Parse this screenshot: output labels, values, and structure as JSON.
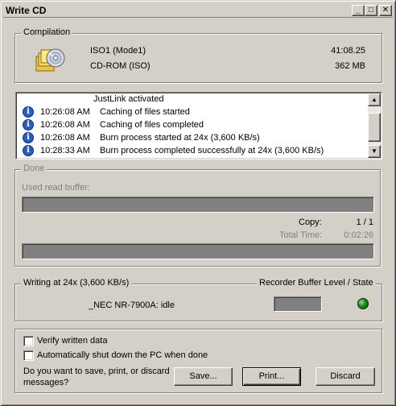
{
  "window": {
    "title": "Write CD",
    "min_glyph": "_",
    "max_glyph": "□",
    "close_glyph": "✕"
  },
  "compilation": {
    "label": "Compilation",
    "icon": "cd-compilation-icon",
    "name": "ISO1 (Mode1)",
    "type": "CD-ROM (ISO)",
    "duration": "41:08.25",
    "size": "362 MB"
  },
  "log": {
    "scroll_up": "▲",
    "scroll_down": "▼",
    "top_line": "JustLink activated",
    "rows": [
      {
        "icon": "info-icon",
        "time": "10:26:08 AM",
        "message": "Caching of files started"
      },
      {
        "icon": "info-icon",
        "time": "10:26:08 AM",
        "message": "Caching of files completed"
      },
      {
        "icon": "info-icon",
        "time": "10:26:08 AM",
        "message": "Burn process started at 24x (3,600 KB/s)"
      },
      {
        "icon": "info-icon",
        "time": "10:28:33 AM",
        "message": "Burn process completed successfully at 24x (3,600 KB/s)"
      }
    ]
  },
  "done": {
    "label": "Done",
    "used_read_buffer_label": "Used read buffer:",
    "copy_label": "Copy:",
    "copy_value": "1 / 1",
    "total_time_label": "Total Time:",
    "total_time_value": "0:02:26"
  },
  "writer": {
    "speed_label": "Writing at 24x (3,600 KB/s)",
    "buffer_label": "Recorder Buffer Level / State",
    "device_status": "_NEC NR-7900A:  idle",
    "state_color": "#1a8a1a"
  },
  "options": {
    "verify_label": "Verify written data",
    "verify_checked": false,
    "shutdown_label": "Automatically shut down the PC when done",
    "shutdown_checked": false,
    "question_line1": "Do you want to save, print, or discard",
    "question_line2": "messages?",
    "save_label": "Save...",
    "print_label": "Print...",
    "discard_label": "Discard"
  }
}
